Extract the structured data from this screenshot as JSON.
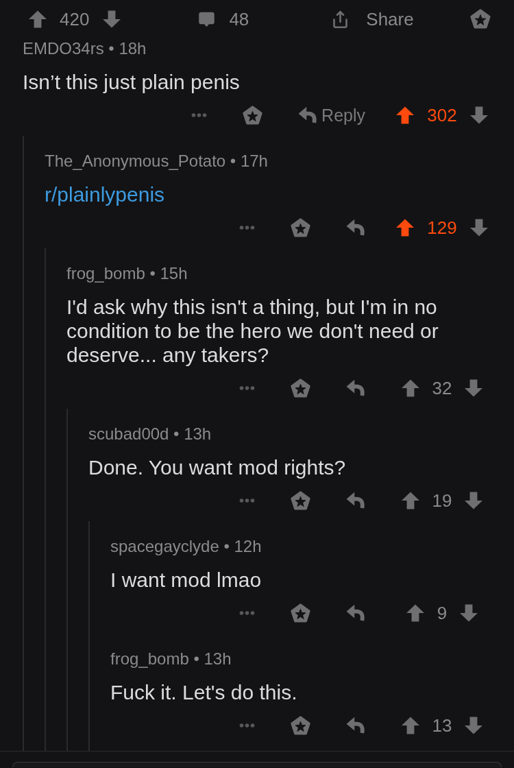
{
  "post_bar": {
    "upvoted": false,
    "score": "420",
    "comment_count": "48",
    "share_label": "Share"
  },
  "comments": [
    {
      "byline": "EMDO34rs • 18h",
      "body": "Isn’t this just plain penis",
      "body_link": false,
      "reply_label": "Reply",
      "upvoted": true,
      "score": "302",
      "children": [
        {
          "byline": "The_Anonymous_Potato • 17h",
          "body": "r/plainlypenis",
          "body_link": true,
          "upvoted": true,
          "score": "129",
          "children": [
            {
              "byline": "frog_bomb • 15h",
              "body": "I'd ask why this isn't a thing, but I'm in no condition to be the hero we don't need or deserve... any takers?",
              "body_link": false,
              "upvoted": false,
              "score": "32",
              "children": [
                {
                  "byline": "scubad00d • 13h",
                  "body": "Done. You want mod rights?",
                  "body_link": false,
                  "upvoted": false,
                  "score": "19",
                  "children": [
                    {
                      "byline": "spacegayclyde • 12h",
                      "body": "I want mod lmao",
                      "body_link": false,
                      "upvoted": false,
                      "score": "9"
                    },
                    {
                      "byline": "frog_bomb • 13h",
                      "body": "Fuck it. Let's do this.",
                      "body_link": false,
                      "upvoted": false,
                      "score": "13"
                    }
                  ]
                }
              ]
            }
          ]
        }
      ]
    }
  ]
}
